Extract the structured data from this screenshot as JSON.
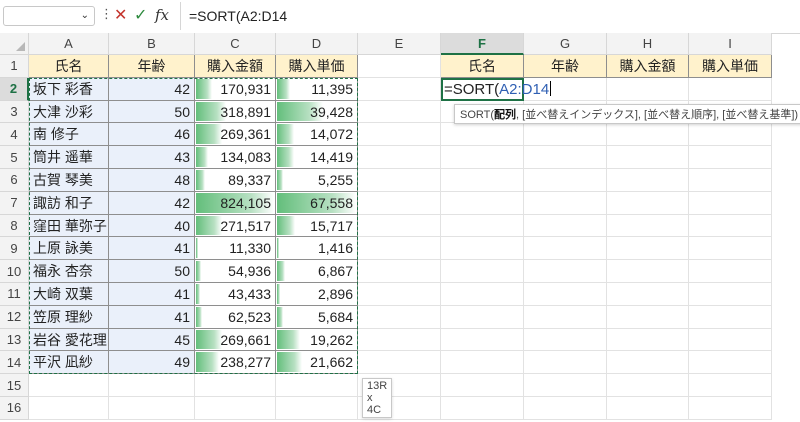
{
  "formula_bar": {
    "namebox_value": "",
    "formula": "=SORT(A2:D14"
  },
  "columns": [
    "A",
    "B",
    "C",
    "D",
    "E",
    "F",
    "G",
    "H",
    "I"
  ],
  "rows": [
    "1",
    "2",
    "3",
    "4",
    "5",
    "6",
    "7",
    "8",
    "9",
    "10",
    "11",
    "12",
    "13",
    "14",
    "15",
    "16"
  ],
  "headers": [
    "氏名",
    "年齢",
    "購入金額",
    "購入単価"
  ],
  "records": [
    {
      "name": "坂下 彩香",
      "age": "42",
      "amount": "170,931",
      "unit": "11,395",
      "amount_fill": 0.21,
      "unit_fill": 0.17
    },
    {
      "name": "大津 沙彩",
      "age": "50",
      "amount": "318,891",
      "unit": "39,428",
      "amount_fill": 0.39,
      "unit_fill": 0.58
    },
    {
      "name": "南 修子",
      "age": "46",
      "amount": "269,361",
      "unit": "14,072",
      "amount_fill": 0.33,
      "unit_fill": 0.21
    },
    {
      "name": "筒井 遥華",
      "age": "43",
      "amount": "134,083",
      "unit": "14,419",
      "amount_fill": 0.16,
      "unit_fill": 0.21
    },
    {
      "name": "古賀 琴美",
      "age": "48",
      "amount": "89,337",
      "unit": "5,255",
      "amount_fill": 0.11,
      "unit_fill": 0.08
    },
    {
      "name": "諏訪 和子",
      "age": "42",
      "amount": "824,105",
      "unit": "67,558",
      "amount_fill": 1.0,
      "unit_fill": 1.0
    },
    {
      "name": "窪田 華弥子",
      "age": "40",
      "amount": "271,517",
      "unit": "15,717",
      "amount_fill": 0.33,
      "unit_fill": 0.23
    },
    {
      "name": "上原 詠美",
      "age": "41",
      "amount": "11,330",
      "unit": "1,416",
      "amount_fill": 0.02,
      "unit_fill": 0.02
    },
    {
      "name": "福永 杏奈",
      "age": "50",
      "amount": "54,936",
      "unit": "6,867",
      "amount_fill": 0.07,
      "unit_fill": 0.1
    },
    {
      "name": "大崎 双葉",
      "age": "41",
      "amount": "43,433",
      "unit": "2,896",
      "amount_fill": 0.05,
      "unit_fill": 0.04
    },
    {
      "name": "笠原 理紗",
      "age": "41",
      "amount": "62,523",
      "unit": "5,684",
      "amount_fill": 0.08,
      "unit_fill": 0.08
    },
    {
      "name": "岩谷 愛花理",
      "age": "45",
      "amount": "269,661",
      "unit": "19,262",
      "amount_fill": 0.33,
      "unit_fill": 0.29
    },
    {
      "name": "平沢 凪紗",
      "age": "49",
      "amount": "238,277",
      "unit": "21,662",
      "amount_fill": 0.29,
      "unit_fill": 0.32
    }
  ],
  "edit_cell": {
    "prefix": "=SORT(",
    "ref": "A2:D14"
  },
  "tooltip": {
    "fn": "SORT(",
    "arg1": "配列",
    "rest": ", [並べ替えインデックス], [並べ替え順序], [並べ替え基準])"
  },
  "size_tip": "13R x 4C",
  "colors": {
    "accent": "#1e7145",
    "ref": "#2f5fb3",
    "header_fill": "#fff2cc",
    "data_fill": "#eaf0fa",
    "databar": "#63be7b"
  }
}
